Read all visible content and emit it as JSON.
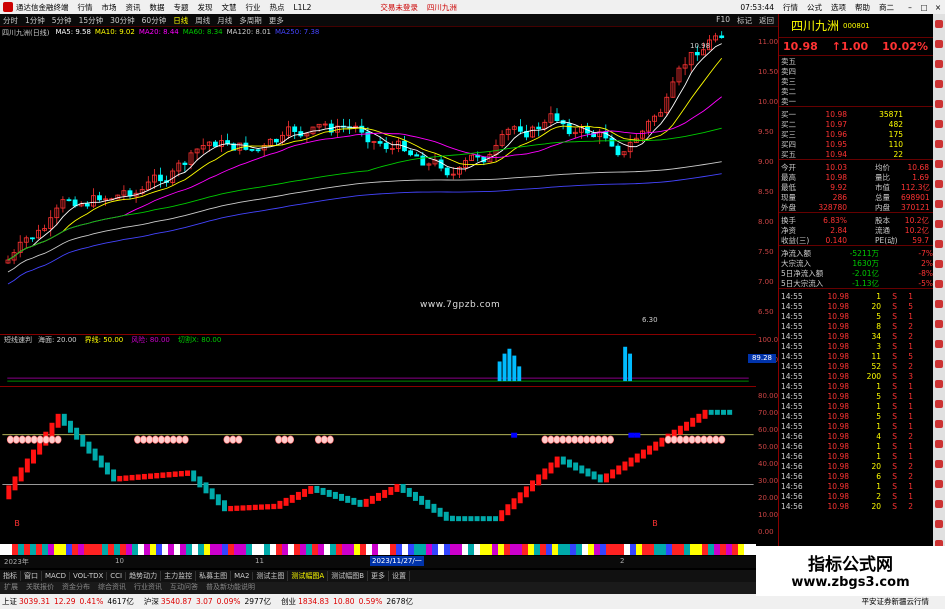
{
  "menubar": {
    "app_title": "通达信金融终端",
    "items": [
      "行情",
      "市场",
      "资讯",
      "数据",
      "专题",
      "发现",
      "文慧",
      "行业",
      "热点",
      "L1L2"
    ],
    "trade_login": "交易未登录",
    "stock_tag": "四川九洲",
    "time": "07:53:44",
    "right_items": [
      "行情",
      "公式",
      "选项",
      "帮助"
    ],
    "tab_right": "商二"
  },
  "toolbar": {
    "periods": [
      "分时",
      "1分钟",
      "5分钟",
      "15分钟",
      "30分钟",
      "60分钟",
      "日线",
      "周线",
      "月线",
      "多周期",
      "更多"
    ],
    "active_period": "日线",
    "right": [
      "F10",
      "标记",
      "返回"
    ]
  },
  "chart": {
    "stock_label": "四川九洲(日线)",
    "ma": [
      {
        "label": "MA5: 9.58",
        "color": "#ffffff"
      },
      {
        "label": "MA10: 9.02",
        "color": "#ffff00"
      },
      {
        "label": "MA20: 8.44",
        "color": "#ff00ff"
      },
      {
        "label": "MA60: 8.34",
        "color": "#00cc00"
      },
      {
        "label": "MA120: 8.01",
        "color": "#cccccc"
      },
      {
        "label": "MA250: 7.38",
        "color": "#4444ff"
      }
    ],
    "high_label": "10.98",
    "low_label": "6.30",
    "site": "www.7gpzb.com",
    "price_ticks": [
      "11.00",
      "10.50",
      "10.00",
      "9.50",
      "9.00",
      "8.50",
      "8.00",
      "7.50",
      "7.00",
      "6.50"
    ]
  },
  "sub1": {
    "title": "短线速判",
    "items": [
      {
        "label": "海面: 20.00",
        "color": "#cccccc"
      },
      {
        "label": "界线: 50.00",
        "color": "#ffff00"
      },
      {
        "label": "风险: 80.00",
        "color": "#cc00cc"
      },
      {
        "label": "切割X: 80.00",
        "color": "#00cc00"
      }
    ],
    "axis_value": "89.28",
    "ticks": [
      "100.00",
      "50.00"
    ]
  },
  "sub2": {
    "ticks": [
      "80.00",
      "70.00",
      "60.00",
      "50.00",
      "40.00",
      "30.00",
      "20.00",
      "10.00",
      "0.00"
    ],
    "buy_marks": [
      "B",
      "B"
    ]
  },
  "datebar": {
    "year": "2023年",
    "month_a": "10",
    "month_b": "11",
    "date_hl": "2023/11/27/一",
    "month_c": "2"
  },
  "bottomtabs": {
    "items": [
      "指标",
      "窗口",
      "MACD",
      "VOL-TDX",
      "CCI",
      "趋势动力",
      "主力监控",
      "私募主图",
      "MA2",
      "测试主图",
      "测试幅图A",
      "测试幅图B",
      "更多",
      "设置"
    ],
    "selected": "测试幅图A",
    "right": "模板"
  },
  "scrollstrip": {
    "items": [
      "扩展",
      "关联报价",
      "资金分布",
      "综合资讯",
      "行业资讯",
      "互动问答",
      "普及新功能说明"
    ]
  },
  "statusbar": {
    "items": [
      {
        "name": "上证",
        "val": "3039.31",
        "chg": "12.29",
        "pct": "0.41%",
        "vol": "4617亿"
      },
      {
        "name": "沪深",
        "val": "3540.87",
        "chg": "3.07",
        "pct": "0.09%",
        "vol": "2977亿"
      },
      {
        "name": "创业",
        "val": "1834.83",
        "chg": "10.80",
        "pct": "0.59%",
        "vol": "2678亿"
      }
    ],
    "right": "平安证券新疆云行情"
  },
  "rpanel": {
    "name": "四川九洲",
    "code": "000801",
    "price": "10.98",
    "change": "↑1.00",
    "pct": "10.02%",
    "asks": [
      {
        "l": "卖五",
        "p": "",
        "v": ""
      },
      {
        "l": "卖四",
        "p": "",
        "v": ""
      },
      {
        "l": "卖三",
        "p": "",
        "v": ""
      },
      {
        "l": "卖二",
        "p": "",
        "v": ""
      },
      {
        "l": "卖一",
        "p": "",
        "v": ""
      }
    ],
    "bids": [
      {
        "l": "买一",
        "p": "10.98",
        "v": "35871"
      },
      {
        "l": "买二",
        "p": "10.97",
        "v": "482"
      },
      {
        "l": "买三",
        "p": "10.96",
        "v": "175"
      },
      {
        "l": "买四",
        "p": "10.95",
        "v": "110"
      },
      {
        "l": "买五",
        "p": "10.94",
        "v": "22"
      }
    ],
    "stats": [
      {
        "a": "今开",
        "b": "10.03",
        "c": "均价",
        "d": "10.68"
      },
      {
        "a": "最高",
        "b": "10.98",
        "c": "量比",
        "d": "1.69"
      },
      {
        "a": "最低",
        "b": "9.92",
        "c": "市值",
        "d": "112.3亿"
      },
      {
        "a": "现量",
        "b": "286",
        "c": "总量",
        "d": "698901"
      },
      {
        "a": "外盘",
        "b": "328780",
        "c": "内盘",
        "d": "370121"
      }
    ],
    "stats2": [
      {
        "a": "换手",
        "b": "6.83%",
        "c": "股本",
        "d": "10.2亿"
      },
      {
        "a": "净资",
        "b": "2.84",
        "c": "流通",
        "d": "10.2亿"
      },
      {
        "a": "收益(三)",
        "b": "0.140",
        "c": "PE(动)",
        "d": "59.7"
      }
    ],
    "flows": [
      {
        "a": "净流入额",
        "b": "-5211万",
        "c": "-7%"
      },
      {
        "a": "大宗流入",
        "b": "1630万",
        "c": "2%"
      },
      {
        "a": "5日净流入额",
        "b": "-2.01亿",
        "c": "-8%"
      },
      {
        "a": "5日大宗流入",
        "b": "-1.13亿",
        "c": "-5%"
      }
    ],
    "ticks": [
      {
        "t": "14:55",
        "p": "10.98",
        "v": "1",
        "d": "S",
        "n": "1"
      },
      {
        "t": "14:55",
        "p": "10.98",
        "v": "20",
        "d": "S",
        "n": "5"
      },
      {
        "t": "14:55",
        "p": "10.98",
        "v": "5",
        "d": "S",
        "n": "1"
      },
      {
        "t": "14:55",
        "p": "10.98",
        "v": "8",
        "d": "S",
        "n": "2"
      },
      {
        "t": "14:55",
        "p": "10.98",
        "v": "34",
        "d": "S",
        "n": "2"
      },
      {
        "t": "14:55",
        "p": "10.98",
        "v": "3",
        "d": "S",
        "n": "1"
      },
      {
        "t": "14:55",
        "p": "10.98",
        "v": "11",
        "d": "S",
        "n": "5"
      },
      {
        "t": "14:55",
        "p": "10.98",
        "v": "52",
        "d": "S",
        "n": "2"
      },
      {
        "t": "14:55",
        "p": "10.98",
        "v": "200",
        "d": "S",
        "n": "3"
      },
      {
        "t": "14:55",
        "p": "10.98",
        "v": "1",
        "d": "S",
        "n": "1"
      },
      {
        "t": "14:55",
        "p": "10.98",
        "v": "5",
        "d": "S",
        "n": "1"
      },
      {
        "t": "14:55",
        "p": "10.98",
        "v": "1",
        "d": "S",
        "n": "1"
      },
      {
        "t": "14:55",
        "p": "10.98",
        "v": "5",
        "d": "S",
        "n": "1"
      },
      {
        "t": "14:55",
        "p": "10.98",
        "v": "1",
        "d": "S",
        "n": "1"
      },
      {
        "t": "14:56",
        "p": "10.98",
        "v": "4",
        "d": "S",
        "n": "2"
      },
      {
        "t": "14:56",
        "p": "10.98",
        "v": "1",
        "d": "S",
        "n": "1"
      },
      {
        "t": "14:56",
        "p": "10.98",
        "v": "1",
        "d": "S",
        "n": "1"
      },
      {
        "t": "14:56",
        "p": "10.98",
        "v": "20",
        "d": "S",
        "n": "2"
      },
      {
        "t": "14:56",
        "p": "10.98",
        "v": "6",
        "d": "S",
        "n": "2"
      },
      {
        "t": "14:56",
        "p": "10.98",
        "v": "1",
        "d": "S",
        "n": "1"
      },
      {
        "t": "14:56",
        "p": "10.98",
        "v": "2",
        "d": "S",
        "n": "1"
      },
      {
        "t": "14:56",
        "p": "10.98",
        "v": "20",
        "d": "S",
        "n": "2"
      }
    ]
  },
  "watermark": {
    "title": "指标公式网",
    "url": "www.zbgs3.com"
  },
  "colors": {
    "up": "#ff3333",
    "down": "#00ffff",
    "bg": "#000000",
    "grid": "#800000"
  }
}
